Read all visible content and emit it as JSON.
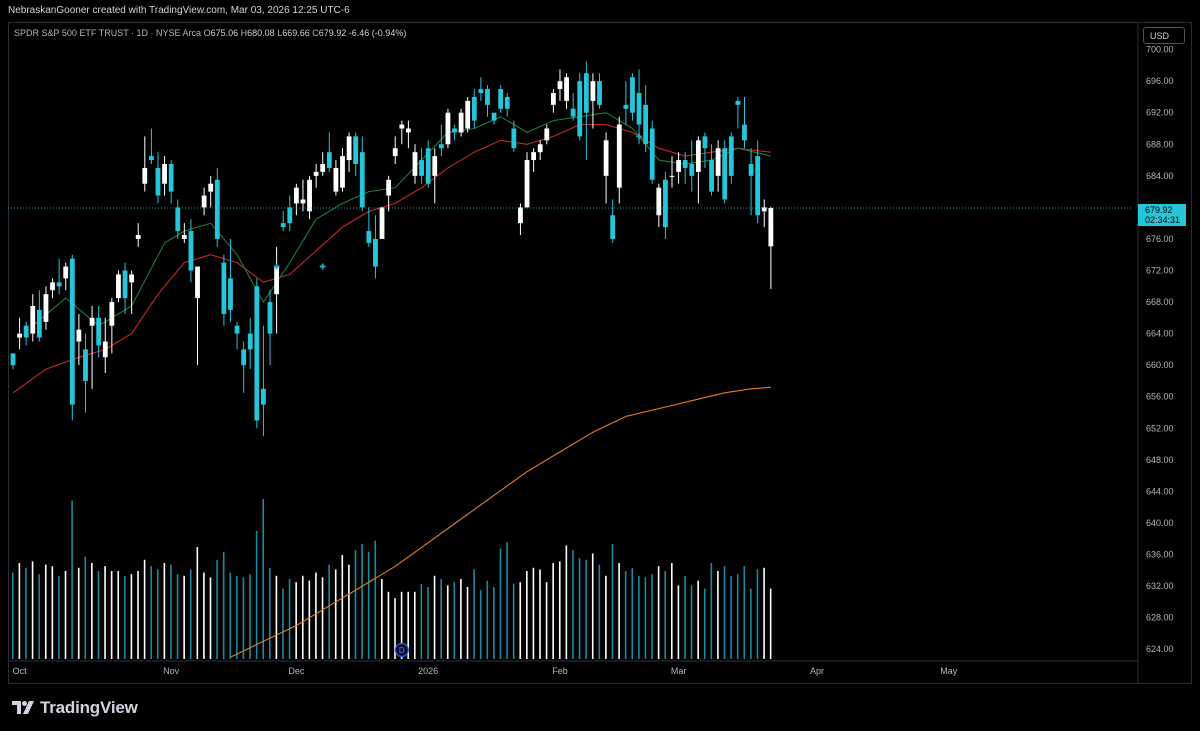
{
  "header": {
    "attribution": "NebraskanGooner created with TradingView.com, Mar 03, 2026 12:25 UTC-6"
  },
  "legend": {
    "symbol": "SPDR S&P 500 ETF TRUST · 1D · NYSE Arca",
    "open_label": "O",
    "open": "675.06",
    "high_label": "H",
    "high": "680.08",
    "low_label": "L",
    "low": "669.66",
    "close_label": "C",
    "close": "679.92",
    "change": "-6.46 (-0.94%)"
  },
  "currency_button": "USD",
  "price_tag": {
    "price": "679.92",
    "countdown": "02:34:31"
  },
  "dividend_marker": "D",
  "brand": "TradingView",
  "colors": {
    "up": "#ffffff",
    "down": "#26c6da",
    "ma_fast": "#1e7b3a",
    "ma_slow": "#c62828",
    "ma_long": "#e67e22",
    "price_line": "#26c6da",
    "volume_up": "#ffffff",
    "volume_down": "#1e88a0"
  },
  "chart_data": {
    "type": "candlestick",
    "y_ticks": [
      "700.00",
      "696.00",
      "692.00",
      "688.00",
      "684.00",
      "680.00",
      "676.00",
      "672.00",
      "668.00",
      "664.00",
      "660.00",
      "656.00",
      "652.00",
      "648.00",
      "644.00",
      "640.00",
      "636.00",
      "632.00",
      "628.00",
      "624.00"
    ],
    "ylim": [
      622.5,
      703.5
    ],
    "x_labels": [
      {
        "label": "Oct",
        "bar": 1
      },
      {
        "label": "Nov",
        "bar": 24
      },
      {
        "label": "Dec",
        "bar": 43
      },
      {
        "label": "2026",
        "bar": 63
      },
      {
        "label": "Feb",
        "bar": 83
      },
      {
        "label": "Mar",
        "bar": 101
      },
      {
        "label": "Apr",
        "bar": 122
      },
      {
        "label": "May",
        "bar": 142
      }
    ],
    "bars_total": 149,
    "candles": [
      [
        661.5,
        661.5,
        659.5,
        660.0
      ],
      [
        663.5,
        666.0,
        662.0,
        664.0
      ],
      [
        665.0,
        665.5,
        662.5,
        663.5
      ],
      [
        664.0,
        669.0,
        663.0,
        667.5
      ],
      [
        667.0,
        669.5,
        663.0,
        663.5
      ],
      [
        665.5,
        670.0,
        664.5,
        669.0
      ],
      [
        669.5,
        671.0,
        668.5,
        670.5
      ],
      [
        670.5,
        673.5,
        669.0,
        670.0
      ],
      [
        671.0,
        673.0,
        669.5,
        672.5
      ],
      [
        673.5,
        674.0,
        653.0,
        655.0
      ],
      [
        663.0,
        666.5,
        660.0,
        664.5
      ],
      [
        662.0,
        664.0,
        654.0,
        658.0
      ],
      [
        665.0,
        667.5,
        657.0,
        666.0
      ],
      [
        666.0,
        667.5,
        661.0,
        662.5
      ],
      [
        661.0,
        666.0,
        659.0,
        663.0
      ],
      [
        665.0,
        668.5,
        661.5,
        668.0
      ],
      [
        668.5,
        672.0,
        668.0,
        671.5
      ],
      [
        672.0,
        673.0,
        666.5,
        668.5
      ],
      [
        670.5,
        672.0,
        666.5,
        671.5
      ],
      [
        676.0,
        678.0,
        675.0,
        676.5
      ],
      [
        683.0,
        689.0,
        682.0,
        685.0
      ],
      [
        686.5,
        690.0,
        685.5,
        686.0
      ],
      [
        685.0,
        687.0,
        680.5,
        681.5
      ],
      [
        683.0,
        686.5,
        681.5,
        685.5
      ],
      [
        685.5,
        686.0,
        680.5,
        682.0
      ],
      [
        680.0,
        681.0,
        676.0,
        677.0
      ],
      [
        676.0,
        678.0,
        675.5,
        676.5
      ],
      [
        677.0,
        678.5,
        670.5,
        672.0
      ],
      [
        668.5,
        669.0,
        660.0,
        672.5
      ],
      [
        680.0,
        682.5,
        679.0,
        681.5
      ],
      [
        682.0,
        684.0,
        680.0,
        683.0
      ],
      [
        683.5,
        685.0,
        675.0,
        676.0
      ],
      [
        673.0,
        674.0,
        665.0,
        666.5
      ],
      [
        671.0,
        676.0,
        665.5,
        667.0
      ],
      [
        665.0,
        665.5,
        662.0,
        664.0
      ],
      [
        662.0,
        663.0,
        656.5,
        660.0
      ],
      [
        664.0,
        666.0,
        659.5,
        662.0
      ],
      [
        670.0,
        671.0,
        652.0,
        653.0
      ],
      [
        657.0,
        665.0,
        651.0,
        655.0
      ],
      [
        668.0,
        669.5,
        660.0,
        664.0
      ],
      [
        669.0,
        675.0,
        664.0,
        672.5
      ],
      [
        678.0,
        679.5,
        677.0,
        677.5
      ],
      [
        680.0,
        681.5,
        677.0,
        678.0
      ],
      [
        680.5,
        683.0,
        679.0,
        682.5
      ],
      [
        680.5,
        683.5,
        679.5,
        681.0
      ],
      [
        679.5,
        684.0,
        678.5,
        683.5
      ],
      [
        684.0,
        685.5,
        682.5,
        684.5
      ],
      [
        684.5,
        687.0,
        684.0,
        685.5
      ],
      [
        687.0,
        689.5,
        684.5,
        685.0
      ],
      [
        682.0,
        686.0,
        681.5,
        685.0
      ],
      [
        682.5,
        687.5,
        682.0,
        686.5
      ],
      [
        686.0,
        689.5,
        684.5,
        689.0
      ],
      [
        689.0,
        689.5,
        684.0,
        685.5
      ],
      [
        687.0,
        689.0,
        679.5,
        680.0
      ],
      [
        677.0,
        680.0,
        675.0,
        675.5
      ],
      [
        676.0,
        679.0,
        671.0,
        672.5
      ],
      [
        676.0,
        680.0,
        676.0,
        680.0
      ],
      [
        681.5,
        684.0,
        679.5,
        683.5
      ],
      [
        686.5,
        689.0,
        685.5,
        687.5
      ],
      [
        690.0,
        691.0,
        688.0,
        690.5
      ],
      [
        689.5,
        691.0,
        687.5,
        690.0
      ],
      [
        684.0,
        688.0,
        683.0,
        687.0
      ],
      [
        686.0,
        687.5,
        683.0,
        684.0
      ],
      [
        687.5,
        688.5,
        682.5,
        683.0
      ],
      [
        684.0,
        687.5,
        680.5,
        686.5
      ],
      [
        688.0,
        690.5,
        686.5,
        687.5
      ],
      [
        688.0,
        692.5,
        687.5,
        692.0
      ],
      [
        690.0,
        690.5,
        688.5,
        689.5
      ],
      [
        689.5,
        692.5,
        689.0,
        692.0
      ],
      [
        690.0,
        694.0,
        689.5,
        693.5
      ],
      [
        694.0,
        695.0,
        690.0,
        691.0
      ],
      [
        695.0,
        696.5,
        693.5,
        694.5
      ],
      [
        695.0,
        695.5,
        691.5,
        693.0
      ],
      [
        692.0,
        692.0,
        690.5,
        691.0
      ],
      [
        695.0,
        695.5,
        692.0,
        692.5
      ],
      [
        694.0,
        694.5,
        691.5,
        692.5
      ],
      [
        690.0,
        691.0,
        687.0,
        687.5
      ],
      [
        678.0,
        680.5,
        676.5,
        680.0
      ],
      [
        680.0,
        687.0,
        680.0,
        686.0
      ],
      [
        686.0,
        687.5,
        684.5,
        687.0
      ],
      [
        687.0,
        688.5,
        686.0,
        688.0
      ],
      [
        688.5,
        690.5,
        688.0,
        690.0
      ],
      [
        693.0,
        695.0,
        692.0,
        694.5
      ],
      [
        695.0,
        697.5,
        693.5,
        696.0
      ],
      [
        693.5,
        697.0,
        692.5,
        696.5
      ],
      [
        692.5,
        694.5,
        691.0,
        691.5
      ],
      [
        696.0,
        697.0,
        688.5,
        689.0
      ],
      [
        697.0,
        698.5,
        686.0,
        692.0
      ],
      [
        693.5,
        697.0,
        690.0,
        696.0
      ],
      [
        696.0,
        697.0,
        692.5,
        693.0
      ],
      [
        684.0,
        689.5,
        680.5,
        688.5
      ],
      [
        679.0,
        681.0,
        675.5,
        676.0
      ],
      [
        682.5,
        691.5,
        680.5,
        690.5
      ],
      [
        693.0,
        696.0,
        690.5,
        692.5
      ],
      [
        696.5,
        697.0,
        691.0,
        692.0
      ],
      [
        694.5,
        697.5,
        688.0,
        690.5
      ],
      [
        693.0,
        695.5,
        687.0,
        688.0
      ],
      [
        690.0,
        691.0,
        683.0,
        683.5
      ],
      [
        679.0,
        683.0,
        677.5,
        682.5
      ],
      [
        683.5,
        684.5,
        676.0,
        677.5
      ],
      [
        684.0,
        686.5,
        682.5,
        684.0
      ],
      [
        684.5,
        687.0,
        683.0,
        686.0
      ],
      [
        686.0,
        687.0,
        683.0,
        685.0
      ],
      [
        685.5,
        688.5,
        682.0,
        684.0
      ],
      [
        684.5,
        689.0,
        680.5,
        688.5
      ],
      [
        689.0,
        689.5,
        685.0,
        687.5
      ],
      [
        686.0,
        688.0,
        681.5,
        682.0
      ],
      [
        684.0,
        688.5,
        682.0,
        687.5
      ],
      [
        687.5,
        688.5,
        680.5,
        681.0
      ],
      [
        689.0,
        689.5,
        683.0,
        684.0
      ],
      [
        693.5,
        694.0,
        690.0,
        693.0
      ],
      [
        690.5,
        694.0,
        687.5,
        688.5
      ],
      [
        685.5,
        687.5,
        679.0,
        684.0
      ],
      [
        686.5,
        688.5,
        678.0,
        679.0
      ],
      [
        679.5,
        681.0,
        677.5,
        680.0
      ],
      [
        675.06,
        680.08,
        669.66,
        679.92
      ]
    ],
    "volume_heights": [
      0.54,
      0.6,
      0.57,
      0.61,
      0.53,
      0.59,
      0.58,
      0.52,
      0.55,
      0.99,
      0.57,
      0.64,
      0.6,
      0.55,
      0.58,
      0.55,
      0.55,
      0.52,
      0.53,
      0.55,
      0.62,
      0.58,
      0.56,
      0.6,
      0.59,
      0.53,
      0.52,
      0.56,
      0.7,
      0.54,
      0.51,
      0.62,
      0.67,
      0.54,
      0.52,
      0.51,
      0.53,
      0.8,
      1.0,
      0.57,
      0.52,
      0.44,
      0.5,
      0.48,
      0.52,
      0.49,
      0.54,
      0.51,
      0.59,
      0.56,
      0.65,
      0.59,
      0.68,
      0.72,
      0.67,
      0.74,
      0.5,
      0.42,
      0.38,
      0.42,
      0.42,
      0.42,
      0.47,
      0.45,
      0.52,
      0.5,
      0.46,
      0.48,
      0.5,
      0.45,
      0.56,
      0.43,
      0.49,
      0.45,
      0.69,
      0.73,
      0.47,
      0.48,
      0.55,
      0.57,
      0.56,
      0.48,
      0.6,
      0.61,
      0.71,
      0.68,
      0.63,
      0.62,
      0.66,
      0.59,
      0.52,
      0.72,
      0.6,
      0.55,
      0.57,
      0.52,
      0.51,
      0.53,
      0.58,
      0.55,
      0.6,
      0.46,
      0.52,
      0.46,
      0.49,
      0.44,
      0.6,
      0.55,
      0.58,
      0.52,
      0.53,
      0.58,
      0.44,
      0.56,
      0.57,
      0.44
    ],
    "ma_fast": [
      [
        3,
        665.0
      ],
      [
        8,
        668.5
      ],
      [
        13,
        665.0
      ],
      [
        18,
        667.5
      ],
      [
        23,
        675.5
      ],
      [
        26,
        677.0
      ],
      [
        30,
        678.0
      ],
      [
        34,
        674.0
      ],
      [
        38,
        668.0
      ],
      [
        42,
        673.0
      ],
      [
        46,
        678.5
      ],
      [
        50,
        680.5
      ],
      [
        54,
        682.0
      ],
      [
        58,
        682.5
      ],
      [
        62,
        686.0
      ],
      [
        66,
        689.5
      ],
      [
        70,
        690.0
      ],
      [
        74,
        691.5
      ],
      [
        78,
        689.5
      ],
      [
        82,
        691.0
      ],
      [
        86,
        691.5
      ],
      [
        90,
        692.0
      ],
      [
        94,
        690.0
      ],
      [
        98,
        686.0
      ],
      [
        102,
        685.5
      ],
      [
        106,
        686.0
      ],
      [
        110,
        687.5
      ],
      [
        115,
        686.5
      ]
    ],
    "ma_slow": [
      [
        0,
        656.5
      ],
      [
        5,
        659.5
      ],
      [
        10,
        661.0
      ],
      [
        14,
        662.0
      ],
      [
        18,
        664.0
      ],
      [
        22,
        669.0
      ],
      [
        26,
        673.0
      ],
      [
        30,
        674.0
      ],
      [
        34,
        673.0
      ],
      [
        38,
        670.5
      ],
      [
        42,
        671.5
      ],
      [
        46,
        674.5
      ],
      [
        50,
        677.5
      ],
      [
        54,
        679.5
      ],
      [
        58,
        680.5
      ],
      [
        62,
        682.5
      ],
      [
        66,
        685.0
      ],
      [
        70,
        687.0
      ],
      [
        74,
        688.5
      ],
      [
        78,
        688.0
      ],
      [
        82,
        689.0
      ],
      [
        86,
        690.5
      ],
      [
        90,
        690.5
      ],
      [
        94,
        689.5
      ],
      [
        98,
        687.5
      ],
      [
        102,
        686.5
      ],
      [
        106,
        687.0
      ],
      [
        110,
        687.5
      ],
      [
        115,
        687.0
      ]
    ],
    "ma_long": [
      [
        33,
        623.0
      ],
      [
        38,
        625.0
      ],
      [
        43,
        627.0
      ],
      [
        48,
        629.5
      ],
      [
        53,
        632.0
      ],
      [
        58,
        634.5
      ],
      [
        63,
        637.5
      ],
      [
        68,
        640.5
      ],
      [
        73,
        643.5
      ],
      [
        78,
        646.5
      ],
      [
        83,
        649.0
      ],
      [
        88,
        651.5
      ],
      [
        93,
        653.5
      ],
      [
        98,
        654.5
      ],
      [
        103,
        655.5
      ],
      [
        108,
        656.5
      ],
      [
        112,
        657.0
      ],
      [
        115,
        657.2
      ]
    ],
    "markers": [
      {
        "bar": 40,
        "price": 672.5
      },
      {
        "bar": 47,
        "price": 672.5
      },
      {
        "bar": 95,
        "price": 689.0
      }
    ]
  }
}
